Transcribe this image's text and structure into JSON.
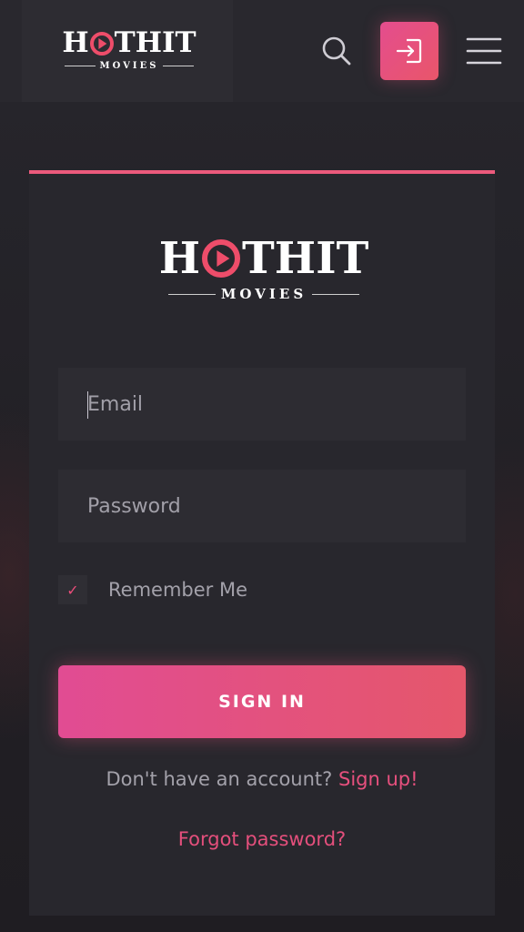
{
  "brand": {
    "logo_letters_left": "H",
    "logo_letters_right": "THIT",
    "logo_subtitle": "MOVIES"
  },
  "header": {
    "search_icon": "search-icon",
    "signin_icon": "sign-in-icon",
    "menu_icon": "hamburger-menu-icon"
  },
  "form": {
    "email_placeholder": "Email",
    "password_placeholder": "Password",
    "remember_label": "Remember Me",
    "remember_checked": true,
    "checkmark": "✓",
    "submit_label": "SIGN IN",
    "no_account_text": "Don't have an account? ",
    "signup_link": "Sign up!",
    "forgot_link": "Forgot password?"
  },
  "colors": {
    "accent": "#ec5a7c",
    "accent_gradient_start": "#e14c93",
    "accent_gradient_end": "#e5576b",
    "background": "#232227",
    "card": "#28272d",
    "field": "#2d2c32"
  }
}
